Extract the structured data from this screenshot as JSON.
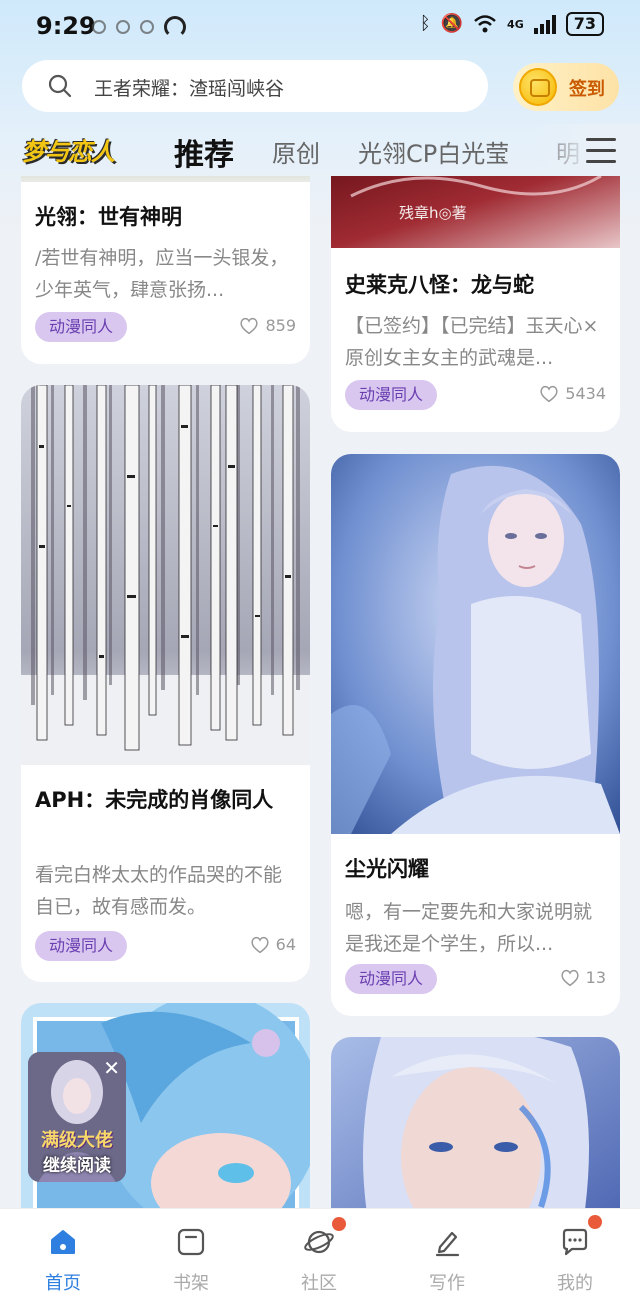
{
  "status": {
    "time": "9:29",
    "network": "4G",
    "battery": "73"
  },
  "search": {
    "placeholder": "王者荣耀：渣瑶闯峡谷"
  },
  "checkin": {
    "label": "签到"
  },
  "tabs": {
    "logo": "梦与恋人",
    "items": [
      "推荐",
      "原创",
      "光翎CP白光莹",
      "明"
    ],
    "active_index": 0
  },
  "feed": {
    "left": [
      {
        "title": "光翎：世有神明",
        "desc": "/若世有神明，应当一头银发，少年英气，肆意张扬...",
        "tag": "动漫同人",
        "likes": "859"
      },
      {
        "title": "APH：未完成的肖像同人",
        "desc": "看完白桦太太的作品哭的不能自已，故有感而发。",
        "tag": "动漫同人",
        "likes": "64"
      }
    ],
    "right": [
      {
        "cover_text": "残章h◎著",
        "title": "史莱克八怪：龙与蛇",
        "desc": "【已签约】【已完结】玉天心×原创女主女主的武魂是...",
        "tag": "动漫同人",
        "likes": "5434"
      },
      {
        "title": "尘光闪耀",
        "desc": "嗯，有一定要先和大家说明就是我还是个学生，所以...",
        "tag": "动漫同人",
        "likes": "13"
      }
    ]
  },
  "floating": {
    "title": "满级大佬",
    "label": "继续阅读",
    "close": "✕"
  },
  "bottom_nav": {
    "items": [
      "首页",
      "书架",
      "社区",
      "写作",
      "我的"
    ],
    "active_index": 0,
    "accent": "#2e7fe0"
  }
}
